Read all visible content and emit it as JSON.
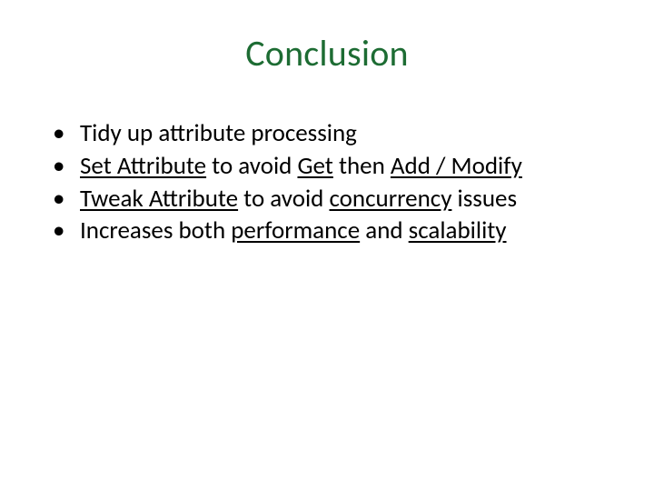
{
  "title": "Conclusion",
  "bullets": [
    {
      "segs": [
        {
          "t": "Tidy up attribute processing"
        }
      ]
    },
    {
      "segs": [
        {
          "t": "Set Attribute",
          "u": true
        },
        {
          "t": " to avoid "
        },
        {
          "t": "Get",
          "u": true
        },
        {
          "t": " then "
        },
        {
          "t": "Add / Modify",
          "u": true
        }
      ]
    },
    {
      "segs": [
        {
          "t": "Tweak Attribute",
          "u": true
        },
        {
          "t": " to avoid "
        },
        {
          "t": "concurrency",
          "u": true
        },
        {
          "t": " issues"
        }
      ]
    },
    {
      "segs": [
        {
          "t": "Increases both "
        },
        {
          "t": "performance",
          "u": true
        },
        {
          "t": " and "
        },
        {
          "t": "scalability",
          "u": true
        }
      ]
    }
  ]
}
